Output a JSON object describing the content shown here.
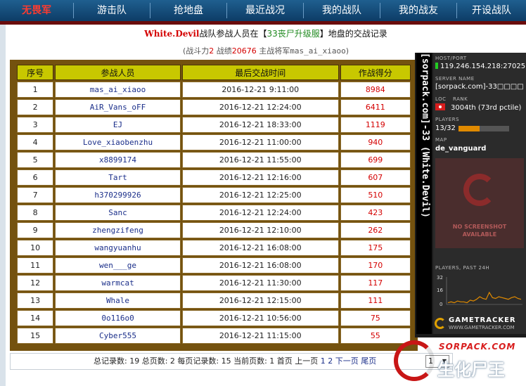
{
  "nav": {
    "items": [
      {
        "label": "无畏军",
        "active": true
      },
      {
        "label": "游击队"
      },
      {
        "label": "抢地盘"
      },
      {
        "label": "最近战况"
      },
      {
        "label": "我的战队"
      },
      {
        "label": "我的战友"
      },
      {
        "label": "开设战队"
      }
    ]
  },
  "heading": {
    "team": "White.Devil",
    "text1": "战队参战人员在【",
    "server": "33丧尸升级服",
    "text2": "】地盘的交战记录"
  },
  "subheading": {
    "p1": "(战斗力",
    "power": "2",
    "p2": " 战绩",
    "score": "20676",
    "p3": " 主战将军",
    "general": "mas_ai_xiaoo",
    "p4": ")"
  },
  "table": {
    "headers": [
      "序号",
      "参战人员",
      "最后交战时间",
      "作战得分"
    ],
    "rows": [
      {
        "idx": "1",
        "name": "mas_ai_xiaoo",
        "time": "2016-12-21  9:11:00",
        "score": "8984"
      },
      {
        "idx": "2",
        "name": "AiR_Vans_oFF",
        "time": "2016-12-21 12:24:00",
        "score": "6411"
      },
      {
        "idx": "3",
        "name": "EJ",
        "time": "2016-12-21 18:33:00",
        "score": "1119"
      },
      {
        "idx": "4",
        "name": "Love_xiaobenzhu",
        "time": "2016-12-21 11:00:00",
        "score": "940"
      },
      {
        "idx": "5",
        "name": "x8899174",
        "time": "2016-12-21 11:55:00",
        "score": "699"
      },
      {
        "idx": "6",
        "name": "Tart",
        "time": "2016-12-21 12:16:00",
        "score": "607"
      },
      {
        "idx": "7",
        "name": "h370299926",
        "time": "2016-12-21 12:25:00",
        "score": "510"
      },
      {
        "idx": "8",
        "name": "Sanc",
        "time": "2016-12-21 12:24:00",
        "score": "423"
      },
      {
        "idx": "9",
        "name": "zhengzifeng",
        "time": "2016-12-21 12:10:00",
        "score": "262"
      },
      {
        "idx": "10",
        "name": "wangyuanhu",
        "time": "2016-12-21 16:08:00",
        "score": "175"
      },
      {
        "idx": "11",
        "name": "wen___ge",
        "time": "2016-12-21 16:08:00",
        "score": "170"
      },
      {
        "idx": "12",
        "name": "warmcat",
        "time": "2016-12-21 11:30:00",
        "score": "117"
      },
      {
        "idx": "13",
        "name": "Whale",
        "time": "2016-12-21 12:15:00",
        "score": "111"
      },
      {
        "idx": "14",
        "name": "0o116o0",
        "time": "2016-12-21 10:56:00",
        "score": "75"
      },
      {
        "idx": "15",
        "name": "Cyber555",
        "time": "2016-12-21 11:15:00",
        "score": "55"
      }
    ]
  },
  "banner": {
    "vertical_text": "[sorpack.com]-33 (White.Devil)",
    "host_label": "HOST/PORT",
    "host": "119.246.154.218:27025",
    "server_label": "SERVER NAME",
    "server_name": "[sorpack.com]-33□□□□",
    "loc_label": "LOC",
    "rank_label": "RANK",
    "rank": "3004th (73rd pctile)",
    "players_label": "PLAYERS",
    "players": "13/32",
    "players_fraction": 0.41,
    "map_label": "MAP",
    "map": "de_vanguard",
    "noshot_line1": "NO SCREENSHOT",
    "noshot_line2": "AVAILABLE",
    "graph_label": "PLAYERS, PAST 24H",
    "graph_ticks": [
      "32",
      "16",
      "0"
    ],
    "graph_values": [
      2,
      3,
      2,
      4,
      3,
      3,
      2,
      5,
      4,
      6,
      9,
      7,
      6,
      14,
      8,
      7,
      9,
      8,
      7,
      6,
      8,
      9,
      7,
      6
    ],
    "graph_max": 32,
    "brand": "GAMETRACKER",
    "brand_url": "WWW.GAMETRACKER.COM",
    "accent": "#e08a00"
  },
  "pager": {
    "t1": "总记录数: 19 总页数: 2 每页记录数: 15 当前页数: 1 首页 上一页 ",
    "p1": "1",
    "p2": "2",
    "next": "下一页",
    "last": "尾页",
    "select_value": "1"
  },
  "watermark": {
    "line1": "SORPACK.COM",
    "line2": "生化尸王"
  }
}
